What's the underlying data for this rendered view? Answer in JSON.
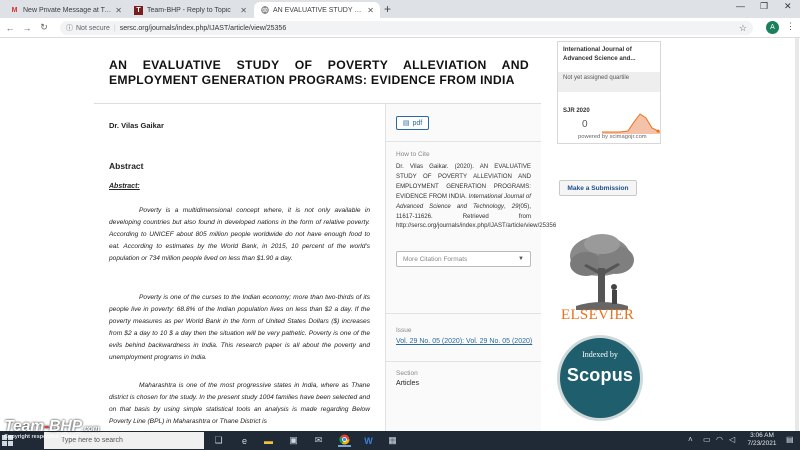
{
  "browser": {
    "tabs": [
      {
        "title": "New Private Message at Team-BHP",
        "favicon": "M",
        "active": false
      },
      {
        "title": "Team-BHP - Reply to Topic",
        "favicon": "T",
        "active": false
      },
      {
        "title": "AN EVALUATIVE STUDY OF POVERTY",
        "favicon": "",
        "active": true
      }
    ],
    "new_tab": "+",
    "not_secure": "Not secure",
    "url": "sersc.org/journals/index.php/IJAST/article/view/25356",
    "avatar_letter": "A"
  },
  "article": {
    "title": "AN EVALUATIVE STUDY OF POVERTY ALLEVIATION AND EMPLOYMENT GENERATION PROGRAMS: EVIDENCE FROM INDIA",
    "author": "Dr. Vilas Gaikar",
    "abstract_heading": "Abstract",
    "abstract_subheading": "Abstract:",
    "paragraphs": [
      "Poverty is a multidimensional concept where, it is not only available in developing countries but also found in developed nations in the form of relative poverty. According to UNICEF about 805 million people worldwide do not have enough food to eat. According to estimates by the World Bank, in 2015, 10 percent of the world's population or 734 million people lived on less than $1.90 a day.",
      "Poverty is one of the curses to the Indian economy; more than two-thirds of its people live in poverty: 68.8% of the Indian population lives on less than $2 a day. If the poverty measures as per World Bank in the form of United States Dollars ($) increases from $2 a day to 10 $ a day then the situation will be very pathetic. Poverty is one of the evils behind backwardness in India. This research paper is all about the poverty and unemployment programs in India.",
      "Maharashtra is one of the most progressive states in India, where as Thane district is chosen for the study. In the present study 1004 families have been selected and on that basis by using simple statistical tools an analysis is made regarding Below Poverty Line (BPL) in Maharashtra or Thane District is"
    ]
  },
  "sidebar_mid": {
    "pdf_label": "pdf",
    "how_to_cite_label": "How to Cite",
    "citation_start": "Dr. Vilas Gaikar. (2020). AN EVALUATIVE STUDY OF POVERTY ALLEVIATION AND EMPLOYMENT GENERATION PROGRAMS: EVIDENCE FROM INDIA. ",
    "citation_journal": "International Journal of Advanced Science and Technology",
    "citation_sep": ", ",
    "citation_volume": "29",
    "citation_end": "(05), 11617-11626. Retrieved from http://sersc.org/journals/index.php/IJAST/article/view/25356",
    "more_formats": "More Citation Formats",
    "issue_label": "Issue",
    "issue_link": "Vol. 29 No. 05 (2020): Vol. 29 No. 05 (2020)",
    "section_label": "Section",
    "section_value": "Articles"
  },
  "sidebar_right": {
    "scimago_journal": "International Journal of Advanced Science and...",
    "scimago_quartile": "Not yet assigned quartile",
    "sjr_label": "SJR 2020",
    "sjr_value": "0",
    "powered_by": "powered by scimagojr.com",
    "submit_label": "Make a Submission",
    "elsevier_word": "ELSEVIER",
    "scopus_indexed": "Indexed by",
    "scopus_word": "Scopus"
  },
  "taskbar": {
    "search_placeholder": "Type here to search",
    "time": "3:06 AM",
    "date": "7/23/2021"
  },
  "watermark": {
    "hosted": "HOSTED ON :",
    "brand_a": "Team",
    "brand_dash": "-",
    "brand_b": "BHP",
    "brand_suffix": ".com",
    "copyright": "Copyright respective owners"
  },
  "colors": {
    "link": "#2b6aa0",
    "elsevier_orange": "#e9711c",
    "scopus_teal": "#1e5e6d",
    "taskbar": "#1f2a36"
  }
}
